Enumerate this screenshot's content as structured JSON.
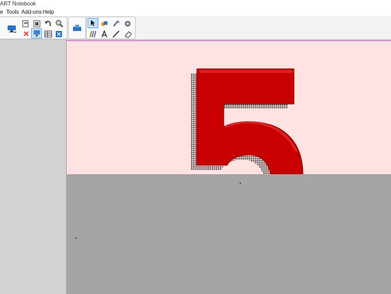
{
  "window": {
    "title": "ART Notebook"
  },
  "menu": [
    {
      "label": ""
    },
    {
      "label": "Tools"
    },
    {
      "label": "Add-ons"
    },
    {
      "label": "Help"
    }
  ],
  "menu_file_fragment": "e",
  "toolbar": {
    "icons": {
      "display": "monitor-icon",
      "delete": "red-x-icon",
      "screen_shade": "screen-shade-icon",
      "table": "table-icon",
      "insert": "insert-icon",
      "open": "open-icon",
      "gallery": "gallery-icon",
      "undo": "undo-icon",
      "zoom": "zoom-icon",
      "capture": "capture-icon",
      "select": "pointer-icon",
      "fill": "fill-icon",
      "eraser_pen": "magic-pen-icon",
      "properties": "properties-icon",
      "creative_pen": "creative-pen-icon",
      "text": "text-icon",
      "line": "line-icon",
      "eraser": "eraser-icon"
    }
  },
  "slide": {
    "background": "#ffe3e2",
    "graphic_text": "5",
    "graphic_color": "#c90000"
  }
}
